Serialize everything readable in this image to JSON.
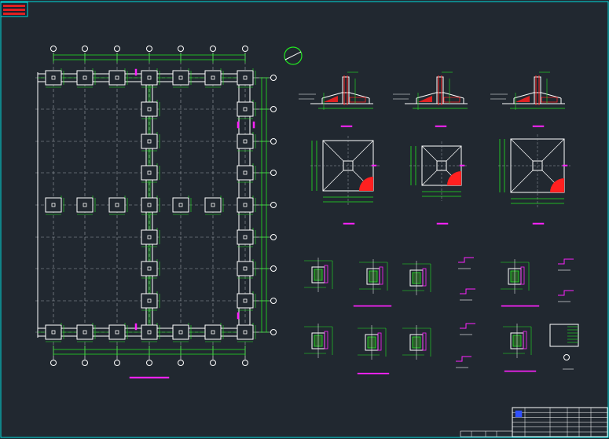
{
  "drawing": {
    "colors": {
      "background": "#212830",
      "frame": "#00e0e0",
      "dimension": "#22e622",
      "outline": "#ffffff",
      "grid": "#9aa0a6",
      "label": "#ff22ff",
      "hatch": "#ff2020",
      "accent": "#3050ff"
    },
    "icons": [
      "toolbar-menu-icon",
      "north-arrow-icon"
    ],
    "title_block": {
      "lines": 6
    }
  }
}
